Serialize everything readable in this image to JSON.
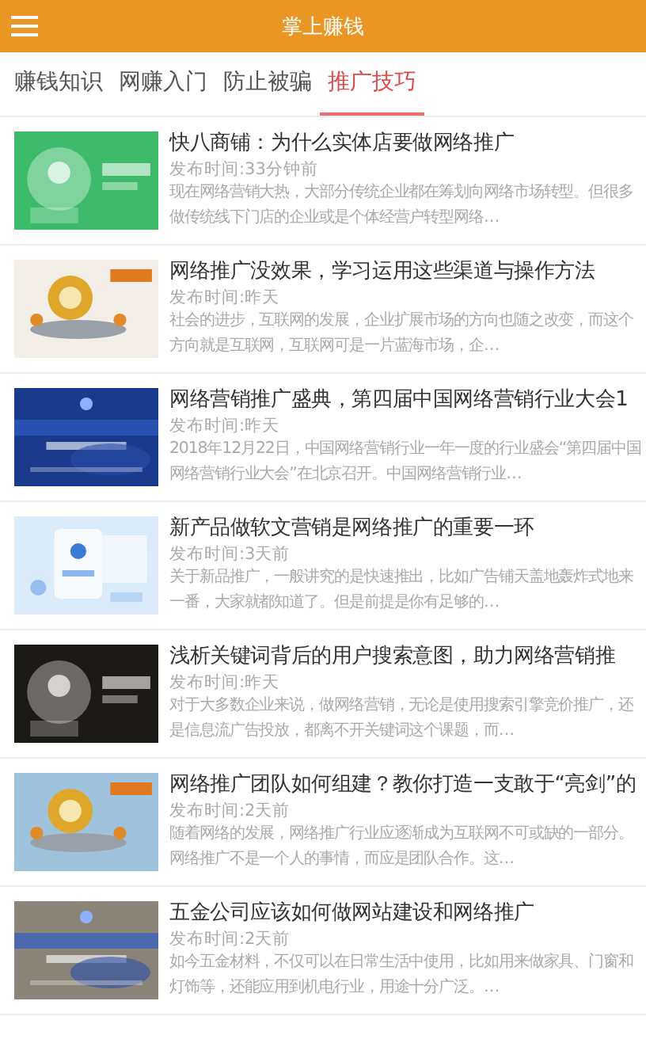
{
  "header": {
    "title": "掌上赚钱"
  },
  "tabs": [
    {
      "label": "赚钱知识",
      "selected": false
    },
    {
      "label": "网赚入门",
      "selected": false
    },
    {
      "label": "防止被骗",
      "selected": false
    },
    {
      "label": "推广技巧",
      "selected": true
    }
  ],
  "articles": [
    {
      "title": "快八商铺：为什么实体店要做网络推广",
      "time": "发布时间:33分钟前",
      "summary": "现在网络营销大热，大部分传统企业都在筹划向网络市场转型。但很多做传统线下门店的企业或是个体经营户转型网络…"
    },
    {
      "title": "网络推广没效果，学习运用这些渠道与操作方法",
      "time": "发布时间:昨天",
      "summary": "社会的进步，互联网的发展，企业扩展市场的方向也随之改变，而这个方向就是互联网，互联网可是一片蓝海市场，企…"
    },
    {
      "title": "网络营销推广盛典，第四届中国网络营销行业大会1",
      "time": "发布时间:昨天",
      "summary": "2018年12月22日，中国网络营销行业一年一度的行业盛会“第四届中国网络营销行业大会”在北京召开。中国网络营销行业…"
    },
    {
      "title": "新产品做软文营销是网络推广的重要一环",
      "time": "发布时间:3天前",
      "summary": "关于新品推广，一般讲究的是快速推出，比如广告铺天盖地轰炸式地来一番，大家就都知道了。但是前提是你有足够的…"
    },
    {
      "title": "浅析关键词背后的用户搜索意图，助力网络营销推",
      "time": "发布时间:昨天",
      "summary": "对于大多数企业来说，做网络营销，无论是使用搜索引擎竞价推广，还是信息流广告投放，都离不开关键词这个课题，而…"
    },
    {
      "title": "网络推广团队如何组建？教你打造一支敢于“亮剑”的",
      "time": "发布时间:2天前",
      "summary": "随着网络的发展，网络推广行业应逐渐成为互联网不可或缺的一部分。网络推广不是一个人的事情，而应是团队合作。这…"
    },
    {
      "title": "五金公司应该如何做网站建设和网络推广",
      "time": "发布时间:2天前",
      "summary": "如今五金材料，不仅可以在日常生活中使用，比如用来做家具、门窗和灯饰等，还能应用到机电行业，用途十分广泛。…"
    }
  ]
}
